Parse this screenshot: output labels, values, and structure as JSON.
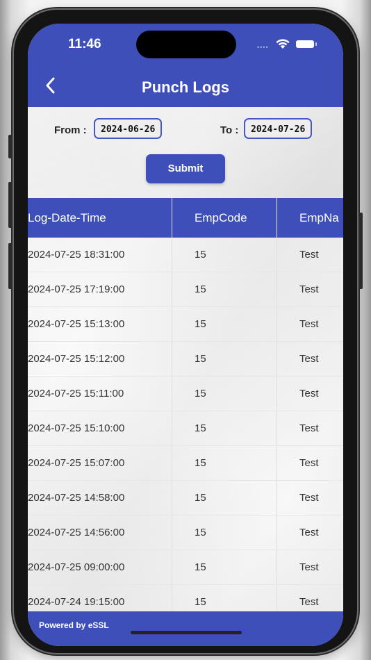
{
  "status_bar": {
    "time": "11:46"
  },
  "header": {
    "title": "Punch Logs"
  },
  "filters": {
    "from_label": "From :",
    "from_value": "2024-06-26",
    "to_label": "To :",
    "to_value": "2024-07-26",
    "submit_label": "Submit"
  },
  "table": {
    "columns": [
      "Log-Date-Time",
      "EmpCode",
      "EmpNa"
    ],
    "rows": [
      [
        "2024-07-25 18:31:00",
        "15",
        "Test"
      ],
      [
        "2024-07-25 17:19:00",
        "15",
        "Test"
      ],
      [
        "2024-07-25 15:13:00",
        "15",
        "Test"
      ],
      [
        "2024-07-25 15:12:00",
        "15",
        "Test"
      ],
      [
        "2024-07-25 15:11:00",
        "15",
        "Test"
      ],
      [
        "2024-07-25 15:10:00",
        "15",
        "Test"
      ],
      [
        "2024-07-25 15:07:00",
        "15",
        "Test"
      ],
      [
        "2024-07-25 14:58:00",
        "15",
        "Test"
      ],
      [
        "2024-07-25 14:56:00",
        "15",
        "Test"
      ],
      [
        "2024-07-25 09:00:00",
        "15",
        "Test"
      ],
      [
        "2024-07-24 19:15:00",
        "15",
        "Test"
      ]
    ]
  },
  "footer": {
    "powered_by": "Powered by eSSL"
  },
  "colors": {
    "primary": "#3e4fb9",
    "background": "#eeeeee"
  }
}
